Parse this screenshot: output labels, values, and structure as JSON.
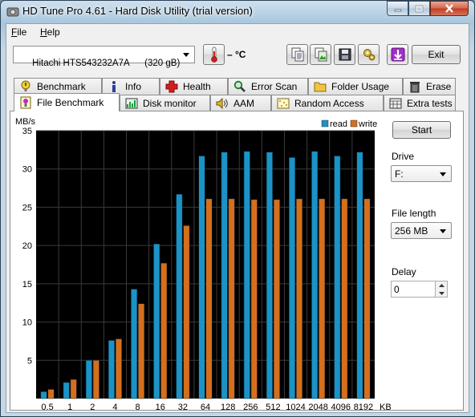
{
  "window": {
    "title": "HD Tune Pro 4.61 - Hard Disk Utility (trial version)"
  },
  "menu": {
    "file": "File",
    "help": "Help"
  },
  "toolbar": {
    "drive": "Hitachi HTS543232A7A      (320 gB)",
    "temperature": "– °C",
    "exit_label": "Exit"
  },
  "tabs_top": [
    {
      "label": "Benchmark",
      "icon": "warning-icon"
    },
    {
      "label": "Info",
      "icon": "info-icon"
    },
    {
      "label": "Health",
      "icon": "health-cross-icon"
    },
    {
      "label": "Error Scan",
      "icon": "magnifier-icon"
    },
    {
      "label": "Folder Usage",
      "icon": "folder-icon"
    },
    {
      "label": "Erase",
      "icon": "trash-icon"
    }
  ],
  "tabs_bottom": [
    {
      "label": "File Benchmark",
      "icon": "file-benchmark-icon",
      "active": true
    },
    {
      "label": "Disk monitor",
      "icon": "disk-monitor-icon"
    },
    {
      "label": "AAM",
      "icon": "speaker-icon"
    },
    {
      "label": "Random Access",
      "icon": "random-access-icon"
    },
    {
      "label": "Extra tests",
      "icon": "extra-tests-icon"
    }
  ],
  "panel": {
    "start_label": "Start",
    "drive_label": "Drive",
    "drive_value": "F:",
    "file_length_label": "File length",
    "file_length_value": "256 MB",
    "delay_label": "Delay",
    "delay_value": "0"
  },
  "chart_data": {
    "type": "bar",
    "ylabel": "MB/s",
    "ylim": [
      0,
      35
    ],
    "yticks": [
      5,
      10,
      15,
      20,
      25,
      30,
      35
    ],
    "categories": [
      "0.5",
      "1",
      "2",
      "4",
      "8",
      "16",
      "32",
      "64",
      "128",
      "256",
      "512",
      "1024",
      "2048",
      "4096",
      "8192"
    ],
    "x_unit": "KB",
    "grid": true,
    "legend_position": "top-right",
    "series": [
      {
        "name": "read",
        "color": "#1b93c7",
        "values": [
          0.9,
          2.1,
          5.0,
          7.6,
          14.3,
          20.2,
          26.7,
          31.7,
          32.2,
          32.3,
          32.2,
          31.5,
          32.3,
          31.7,
          32.2
        ]
      },
      {
        "name": "write",
        "color": "#d66f1b",
        "values": [
          1.2,
          2.5,
          5.0,
          7.8,
          12.4,
          17.7,
          22.6,
          26.1,
          26.1,
          26.0,
          26.0,
          26.1,
          26.1,
          26.1,
          26.1
        ]
      }
    ]
  }
}
